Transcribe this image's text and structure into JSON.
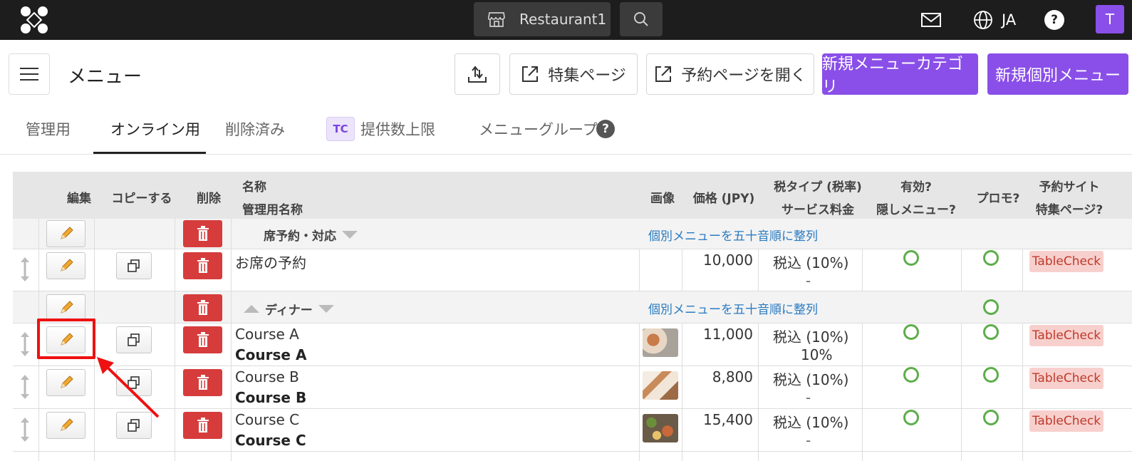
{
  "topbar": {
    "venue_name": "Restaurant1",
    "language": "JA",
    "avatar_initial": "T"
  },
  "header": {
    "page_title": "メニュー",
    "feature_page_label": "特集ページ",
    "open_reservation_label": "予約ページを開く",
    "new_category_label": "新規メニューカテゴリ",
    "new_item_label": "新規個別メニュー"
  },
  "tabs": [
    {
      "label": "管理用"
    },
    {
      "label": "オンライン用"
    },
    {
      "label": "削除済み"
    },
    {
      "label": "提供数上限",
      "badge": "TC"
    },
    {
      "label": "メニューグループ"
    }
  ],
  "table": {
    "headers": {
      "edit": "編集",
      "copy": "コピーする",
      "delete": "削除",
      "name": "名称",
      "admin_name": "管理用名称",
      "image": "画像",
      "price": "価格 (JPY)",
      "tax_type": "税タイプ (税率)",
      "service_charge": "サービス料金",
      "active": "有効?",
      "hidden": "隠しメニュー?",
      "promo": "プロモ?",
      "booking_site": "予約サイト",
      "feature_page": "特集ページ?"
    },
    "sort_link": "個別メニューを五十音順に整列",
    "categories": [
      {
        "name": "席予約・対応",
        "items": [
          {
            "name": "お席の予約",
            "admin_name": "",
            "price": "10,000",
            "tax": "税込 (10%)",
            "service": "-",
            "tag": "TableCheck"
          }
        ]
      },
      {
        "name": "ディナー",
        "items": [
          {
            "name": "Course A",
            "admin_name": "Course A",
            "price": "11,000",
            "tax": "税込 (10%)",
            "service": "10%",
            "tag": "TableCheck"
          },
          {
            "name": "Course B",
            "admin_name": "Course B",
            "price": "8,800",
            "tax": "税込 (10%)",
            "service": "-",
            "tag": "TableCheck"
          },
          {
            "name": "Course C",
            "admin_name": "Course C",
            "price": "15,400",
            "tax": "税込 (10%)",
            "service": "-",
            "tag": "TableCheck"
          }
        ]
      }
    ]
  },
  "colors": {
    "accent": "#8a4fe8",
    "delete": "#d63c3c",
    "ok": "#5cae4a",
    "link": "#2a7bc1",
    "highlight": "#ee1111"
  }
}
